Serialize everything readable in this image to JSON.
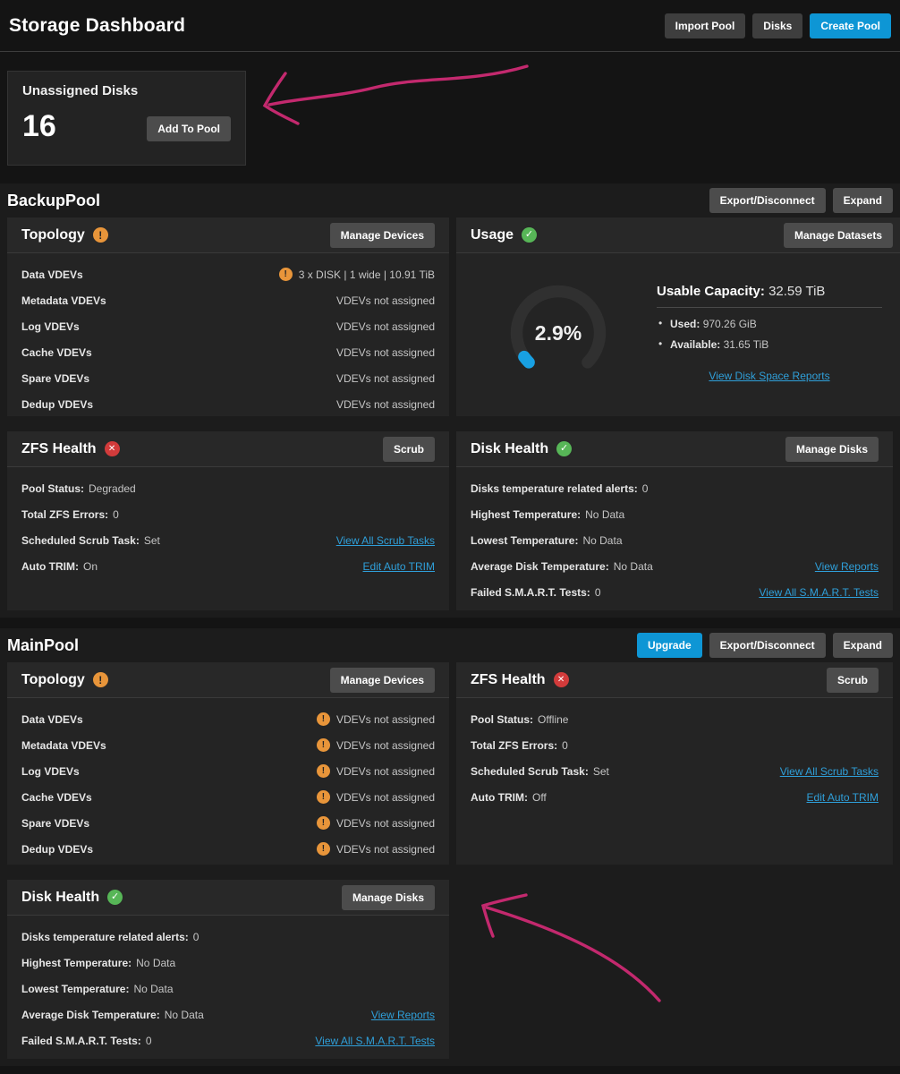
{
  "colors": {
    "accent_blue": "#0e96d5",
    "warning_orange": "#e8953a",
    "success_green": "#57b657",
    "error_red": "#d23b3b",
    "link_blue": "#2f9fd9",
    "annotation_pink": "#c3296e"
  },
  "header": {
    "title": "Storage Dashboard",
    "import_pool_button": "Import Pool",
    "disks_button": "Disks",
    "create_pool_button": "Create Pool"
  },
  "unassigned_disks": {
    "title": "Unassigned Disks",
    "count": "16",
    "add_to_pool_button": "Add To Pool"
  },
  "pools": [
    {
      "name": "BackupPool",
      "export_disconnect_button": "Export/Disconnect",
      "expand_button": "Expand",
      "topology": {
        "title": "Topology",
        "manage_devices_button": "Manage Devices",
        "rows": [
          {
            "label": "Data VDEVs",
            "value": "3 x DISK | 1 wide | 10.91 TiB"
          },
          {
            "label": "Metadata VDEVs",
            "value": "VDEVs not assigned"
          },
          {
            "label": "Log VDEVs",
            "value": "VDEVs not assigned"
          },
          {
            "label": "Cache VDEVs",
            "value": "VDEVs not assigned"
          },
          {
            "label": "Spare VDEVs",
            "value": "VDEVs not assigned"
          },
          {
            "label": "Dedup VDEVs",
            "value": "VDEVs not assigned"
          }
        ]
      },
      "usage": {
        "title": "Usage",
        "manage_datasets_button": "Manage Datasets",
        "percent_used": "2.9%",
        "usable_capacity_label": "Usable Capacity:",
        "usable_capacity": "32.59 TiB",
        "used_label": "Used:",
        "used": "970.26 GiB",
        "available_label": "Available:",
        "available": "31.65 TiB",
        "view_reports_link": "View Disk Space Reports"
      },
      "zfs_health": {
        "title": "ZFS Health",
        "scrub_button": "Scrub",
        "rows": [
          {
            "label": "Pool Status:",
            "value": "Degraded"
          },
          {
            "label": "Total ZFS Errors:",
            "value": "0"
          },
          {
            "label": "Scheduled Scrub Task:",
            "value": "Set",
            "link": "View All Scrub Tasks"
          },
          {
            "label": "Auto TRIM:",
            "value": "On",
            "link": "Edit Auto TRIM"
          }
        ]
      },
      "disk_health": {
        "title": "Disk Health",
        "manage_disks_button": "Manage Disks",
        "rows": [
          {
            "label": "Disks temperature related alerts:",
            "value": "0"
          },
          {
            "label": "Highest Temperature:",
            "value": "No Data"
          },
          {
            "label": "Lowest Temperature:",
            "value": "No Data"
          },
          {
            "label": "Average Disk Temperature:",
            "value": "No Data",
            "link": "View Reports"
          },
          {
            "label": "Failed S.M.A.R.T. Tests:",
            "value": "0",
            "link": "View All S.M.A.R.T. Tests"
          }
        ]
      }
    },
    {
      "name": "MainPool",
      "upgrade_button": "Upgrade",
      "export_disconnect_button": "Export/Disconnect",
      "expand_button": "Expand",
      "topology": {
        "title": "Topology",
        "manage_devices_button": "Manage Devices",
        "rows": [
          {
            "label": "Data VDEVs",
            "value": "VDEVs not assigned"
          },
          {
            "label": "Metadata VDEVs",
            "value": "VDEVs not assigned"
          },
          {
            "label": "Log VDEVs",
            "value": "VDEVs not assigned"
          },
          {
            "label": "Cache VDEVs",
            "value": "VDEVs not assigned"
          },
          {
            "label": "Spare VDEVs",
            "value": "VDEVs not assigned"
          },
          {
            "label": "Dedup VDEVs",
            "value": "VDEVs not assigned"
          }
        ]
      },
      "zfs_health": {
        "title": "ZFS Health",
        "scrub_button": "Scrub",
        "rows": [
          {
            "label": "Pool Status:",
            "value": "Offline"
          },
          {
            "label": "Total ZFS Errors:",
            "value": "0"
          },
          {
            "label": "Scheduled Scrub Task:",
            "value": "Set",
            "link": "View All Scrub Tasks"
          },
          {
            "label": "Auto TRIM:",
            "value": "Off",
            "link": "Edit Auto TRIM"
          }
        ]
      },
      "disk_health": {
        "title": "Disk Health",
        "manage_disks_button": "Manage Disks",
        "rows": [
          {
            "label": "Disks temperature related alerts:",
            "value": "0"
          },
          {
            "label": "Highest Temperature:",
            "value": "No Data"
          },
          {
            "label": "Lowest Temperature:",
            "value": "No Data"
          },
          {
            "label": "Average Disk Temperature:",
            "value": "No Data",
            "link": "View Reports"
          },
          {
            "label": "Failed S.M.A.R.T. Tests:",
            "value": "0",
            "link": "View All S.M.A.R.T. Tests"
          }
        ]
      }
    }
  ],
  "gauge": {
    "percent_value": 2.9
  }
}
